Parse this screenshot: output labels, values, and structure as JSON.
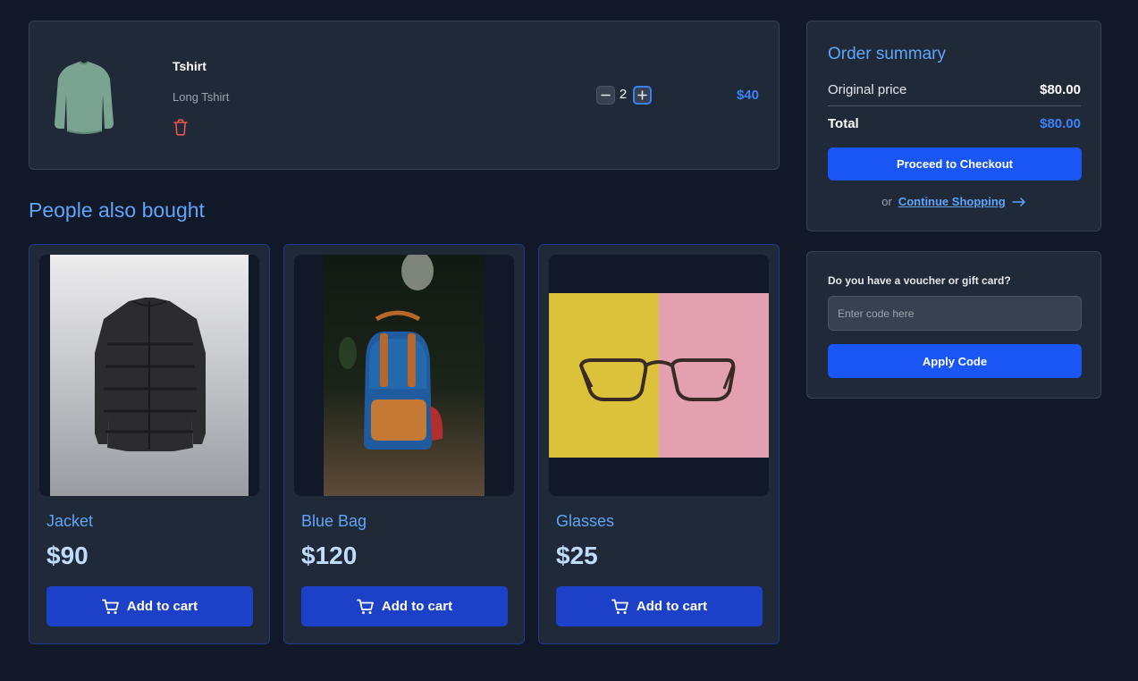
{
  "cart": {
    "item": {
      "name": "Tshirt",
      "description": "Long Tshirt",
      "quantity": "2",
      "price": "$40",
      "image_icon": "tshirt-image"
    }
  },
  "recommendations": {
    "title": "People also bought",
    "products": [
      {
        "name": "Jacket",
        "price": "$90",
        "button_label": "Add to cart",
        "image_icon": "jacket-image"
      },
      {
        "name": "Blue Bag",
        "price": "$120",
        "button_label": "Add to cart",
        "image_icon": "backpack-image"
      },
      {
        "name": "Glasses",
        "price": "$25",
        "button_label": "Add to cart",
        "image_icon": "glasses-image"
      }
    ]
  },
  "summary": {
    "title": "Order summary",
    "original_price_label": "Original price",
    "original_price_value": "$80.00",
    "total_label": "Total",
    "total_value": "$80.00",
    "checkout_label": "Proceed to Checkout",
    "or_text": "or",
    "continue_label": "Continue Shopping"
  },
  "voucher": {
    "label": "Do you have a voucher or gift card?",
    "placeholder": "Enter code here",
    "apply_label": "Apply Code"
  },
  "colors": {
    "background": "#111827",
    "card": "#1f2937",
    "accent": "#60a5fa",
    "primary_button": "#1a56f5",
    "cart_button": "#1d40c9",
    "danger": "#f05252"
  }
}
